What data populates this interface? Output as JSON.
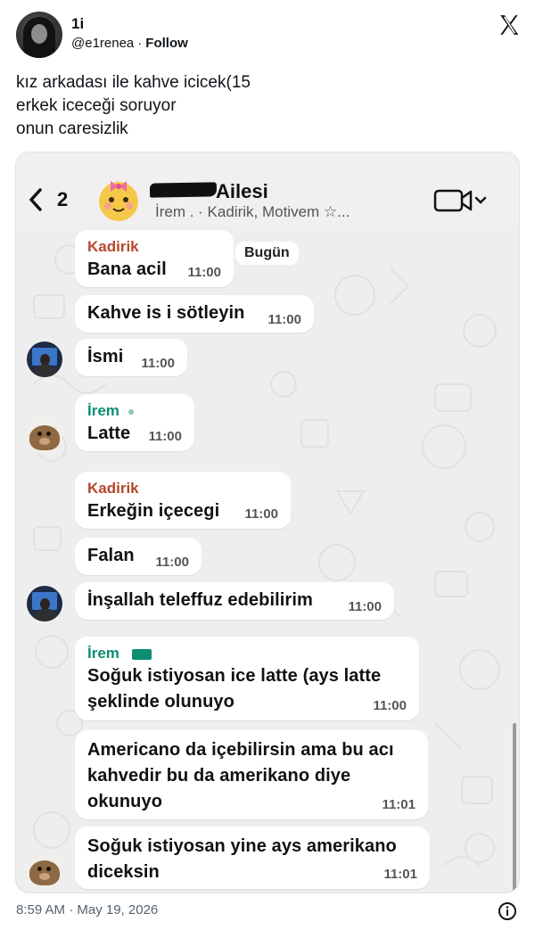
{
  "tweet": {
    "name": "1i",
    "handle": "@e1renea",
    "separator": "·",
    "follow_label": "Follow",
    "text_lines": [
      "kız arkadası ile kahve icicek(15",
      "erkek iceceği soruyor",
      "onun caresizlik"
    ],
    "timestamp": "8:59 AM · May 19, 2026"
  },
  "chat": {
    "back_count": "2",
    "group_name": "Ailesi",
    "members": "İrem .        ·  Kadirik, Motivem ☆...",
    "date_chip": "Bugün",
    "messages": [
      {
        "sender": "Kadirik",
        "text": "Bana acil",
        "time": "11:00"
      },
      {
        "text": "Kahve is i sötleyin",
        "time": "11:00"
      },
      {
        "text": "İsmi",
        "time": "11:00"
      },
      {
        "sender": "İrem",
        "text": "Latte",
        "time": "11:00"
      },
      {
        "sender": "Kadirik",
        "text": "Erkeğin içecegi",
        "time": "11:00"
      },
      {
        "text": "Falan",
        "time": "11:00"
      },
      {
        "text": "İnşallah teleffuz edebilirim",
        "time": "11:00"
      },
      {
        "sender": "İrem",
        "text_lines": [
          "Soğuk istiyosan ice latte (ays latte",
          "şeklinde olunuyo"
        ],
        "time": "11:00"
      },
      {
        "text_lines": [
          "Americano da içebilirsin ama bu acı",
          "kahvedir bu da amerikano diye",
          "okunuyo"
        ],
        "time": "11:01"
      },
      {
        "text_lines": [
          "Soğuk istiyosan yine ays amerikano",
          "diceksin"
        ],
        "time": "11:01"
      }
    ]
  },
  "colors": {
    "kadirik": "#b5472c",
    "irem": "#0d8e72",
    "bubble": "#ffffff",
    "chat_bg": "#eeeeee"
  },
  "icons": [
    "x-logo-icon",
    "back-chevron-icon",
    "video-call-icon",
    "info-icon"
  ]
}
